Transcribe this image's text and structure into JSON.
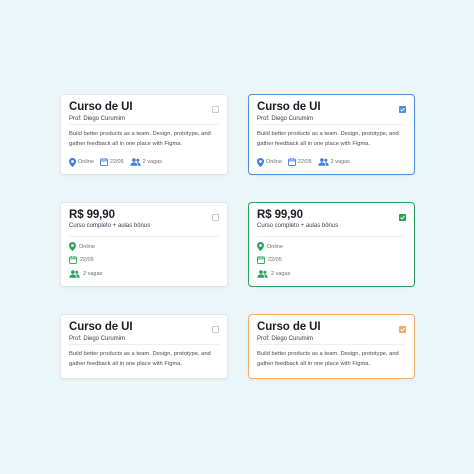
{
  "colors": {
    "background": "#ecf5f8",
    "blue": "#4a90e2",
    "green": "#2e9e5b",
    "orange": "#f0ad6a",
    "icon_blue": "#3d7fd9",
    "icon_green": "#2e9e5b"
  },
  "cards": [
    {
      "title": "Curso de UI",
      "subtitle": "Prof: Diego Curumim",
      "description": "Build better products as a team. Design, prototype, and gather feedback all in one place with Figma.",
      "checked": false,
      "meta": {
        "mode": "Online",
        "date": "22/05",
        "spots": "2 vagas"
      }
    },
    {
      "title": "Curso de UI",
      "subtitle": "Prof: Diego Curumim",
      "description": "Build better products as a team. Design, prototype, and gather feedback all in one place with Figma.",
      "checked": true,
      "meta": {
        "mode": "Online",
        "date": "22/05",
        "spots": "2 vagas"
      }
    },
    {
      "title": "R$ 99,90",
      "subtitle": "Curso completo + aulas bônus",
      "checked": false,
      "meta": {
        "mode": "Online",
        "date": "22/05",
        "spots": "2 vagas"
      }
    },
    {
      "title": "R$ 99,90",
      "subtitle": "Curso completo + aulas bônus",
      "checked": true,
      "meta": {
        "mode": "Online",
        "date": "22/05",
        "spots": "2 vagas"
      }
    },
    {
      "title": "Curso de UI",
      "subtitle": "Prof: Diego Curumim",
      "description": "Build better products as a team. Design, prototype, and gather feedback all in one place with Figma.",
      "checked": false
    },
    {
      "title": "Curso de UI",
      "subtitle": "Prof: Diego Curumim",
      "description": "Build better products as a team. Design, prototype, and gather feedback all in one place with Figma.",
      "checked": true
    }
  ]
}
